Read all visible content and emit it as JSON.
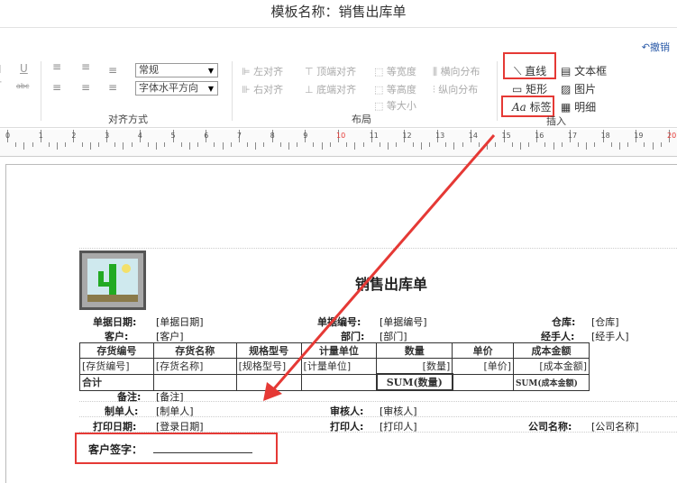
{
  "header": {
    "title": "模板名称：销售出库单",
    "undo_label": "撤销"
  },
  "ribbon": {
    "left_glyphs": {
      "u": "U",
      "abc": "abc"
    },
    "font_style_value": "常规",
    "align_select_value": "字体水平方向",
    "group_align_label": "对齐方式",
    "layout_items": [
      "左对齐",
      "顶端对齐",
      "等宽度",
      "横向分布",
      "右对齐",
      "底端对齐",
      "等高度",
      "纵向分布",
      "等大小"
    ],
    "group_layout_label": "布局",
    "insert_items": [
      "直线",
      "文本框",
      "矩形",
      "图片",
      "标签",
      "明细"
    ],
    "group_insert_label": "插入"
  },
  "ruler": {
    "numbers": [
      "0",
      "1",
      "2",
      "3",
      "4",
      "5",
      "6",
      "7",
      "8",
      "9",
      "10",
      "11",
      "12",
      "13",
      "14",
      "15",
      "16",
      "17",
      "18",
      "19",
      "20"
    ]
  },
  "report": {
    "title": "销售出库单",
    "row1": {
      "l1": "单据日期:",
      "v1": "[单据日期]",
      "l2": "单据编号:",
      "v2": "[单据编号]",
      "l3": "仓库:",
      "v3": "[仓库]"
    },
    "row2": {
      "l1": "客户:",
      "v1": "[客户]",
      "l2": "部门:",
      "v2": "[部门]",
      "l3": "经手人:",
      "v3": "[经手人]"
    },
    "table_headers": [
      "存货编号",
      "存货名称",
      "规格型号",
      "计量单位",
      "数量",
      "单价",
      "成本金额"
    ],
    "table_row": [
      "[存货编号]",
      "[存货名称]",
      "[规格型号]",
      "[计量单位]",
      "[数量]",
      "[单价]",
      "[成本金额]"
    ],
    "total_label": "合计",
    "total_qty": "SUM(数量)",
    "total_cost": "SUM(成本金额)",
    "remark": {
      "label": "备注:",
      "value": "[备注]"
    },
    "maker": {
      "label": "制单人:",
      "value": "[制单人]",
      "label2": "审核人:",
      "value2": "[审核人]"
    },
    "print": {
      "label": "打印日期:",
      "value": "[登录日期]",
      "label2": "打印人:",
      "value2": "[打印人]",
      "label3": "公司名称:",
      "value3": "[公司名称]"
    },
    "signature_label": "客户签字："
  },
  "colors": {
    "highlight": "#e53935",
    "accent": "#2a5aa8"
  }
}
